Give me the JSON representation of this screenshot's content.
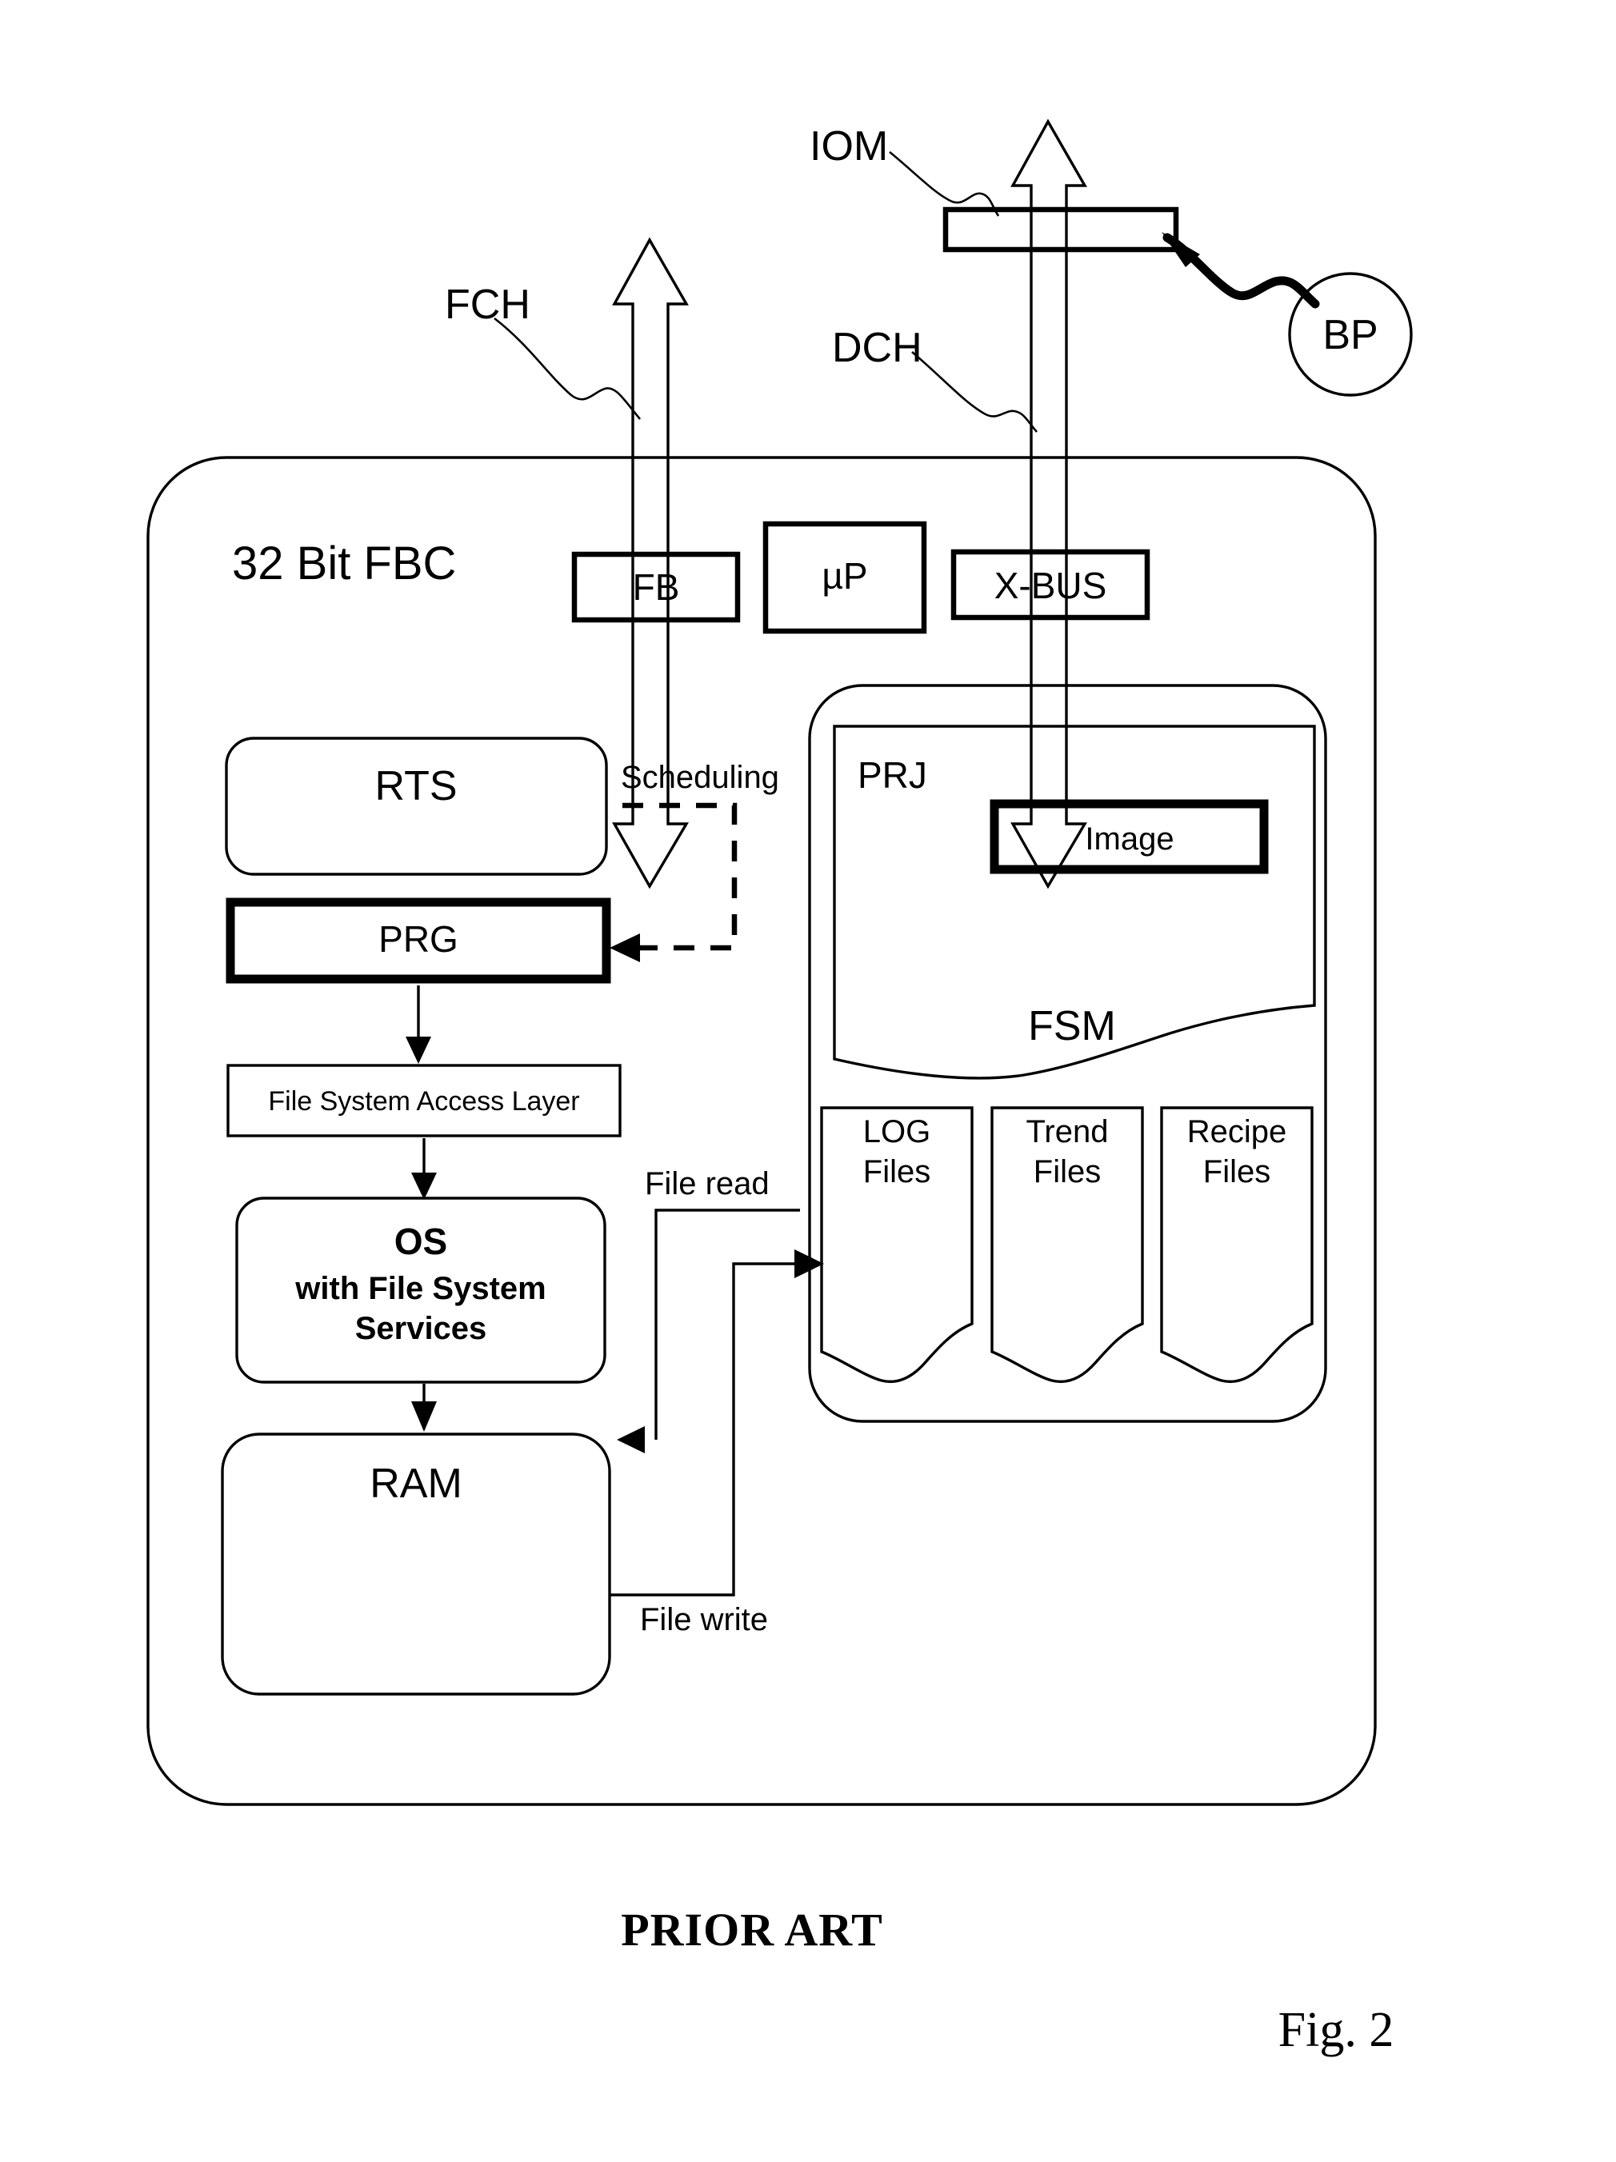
{
  "figure": {
    "caption_prior_art": "PRIOR ART",
    "caption_figure": "Fig. 2",
    "container_label": "32 Bit FBC"
  },
  "external_labels": [
    {
      "id": "fch",
      "text": "FCH"
    },
    {
      "id": "dch",
      "text": "DCH"
    },
    {
      "id": "iom",
      "text": "IOM"
    },
    {
      "id": "bp",
      "text": "BP"
    }
  ],
  "top_blocks": [
    {
      "id": "fb",
      "text": "FB"
    },
    {
      "id": "up",
      "text": "µP"
    },
    {
      "id": "xbus",
      "text": "X-BUS"
    }
  ],
  "left_column": {
    "rts": {
      "label": "RTS"
    },
    "prg": {
      "label": "PRG"
    },
    "fsal": {
      "label": "File System Access Layer"
    },
    "os": {
      "line1": "OS",
      "line2": "with File System",
      "line3": "Services"
    },
    "ram": {
      "label": "RAM"
    }
  },
  "right_column": {
    "fsm_label": "FSM",
    "prj_label": "PRJ",
    "image_label": "Image",
    "files": [
      {
        "line1": "LOG",
        "line2": "Files"
      },
      {
        "line1": "Trend",
        "line2": "Files"
      },
      {
        "line1": "Recipe",
        "line2": "Files"
      }
    ]
  },
  "connection_labels": [
    {
      "id": "scheduling",
      "text": "Scheduling"
    },
    {
      "id": "file-read",
      "text": "File read"
    },
    {
      "id": "file-write",
      "text": "File write"
    }
  ],
  "colors": {
    "stroke": "#000000",
    "background": "#ffffff"
  }
}
